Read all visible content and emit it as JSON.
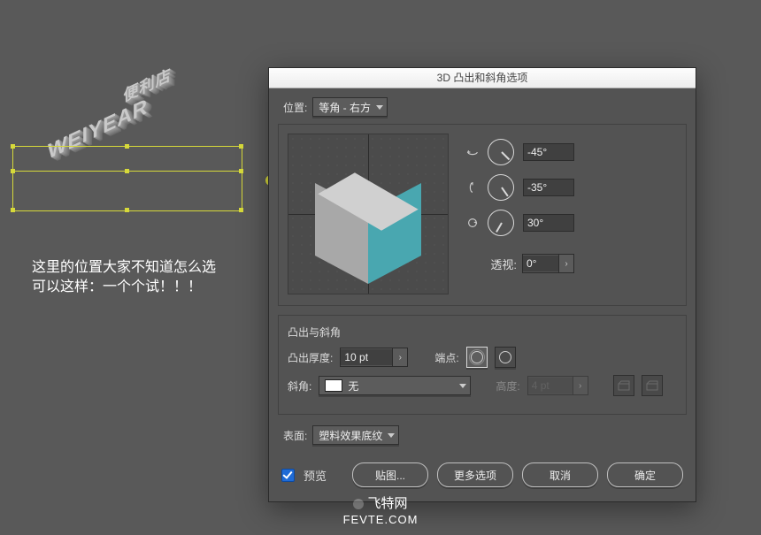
{
  "canvas": {
    "iso_text_line1": "便利店",
    "iso_text_line2": "WEIYEAR"
  },
  "caption": {
    "line1": "这里的位置大家不知道怎么选",
    "line2": "可以这样：一个个试！！！"
  },
  "dialog": {
    "title": "3D 凸出和斜角选项",
    "position_label": "位置:",
    "position_value": "等角 - 右方",
    "rotation": {
      "x": "-45°",
      "y": "-35°",
      "z": "30°"
    },
    "perspective_label": "透视:",
    "perspective_value": "0°",
    "extrude_group_title": "凸出与斜角",
    "extrude_depth_label": "凸出厚度:",
    "extrude_depth_value": "10 pt",
    "cap_label": "端点:",
    "bevel_label": "斜角:",
    "bevel_value": "无",
    "height_label": "高度:",
    "height_value": "4 pt",
    "surface_label": "表面:",
    "surface_value": "塑料效果底纹",
    "preview_label": "预览",
    "map_art_label": "贴图...",
    "more_options_label": "更多选项",
    "cancel_label": "取消",
    "ok_label": "确定"
  },
  "watermark": {
    "line1": "飞特网",
    "line2": "FEVTE.COM"
  },
  "colors": {
    "cube_right": "#49a7b0",
    "selection": "#d6d93a"
  }
}
